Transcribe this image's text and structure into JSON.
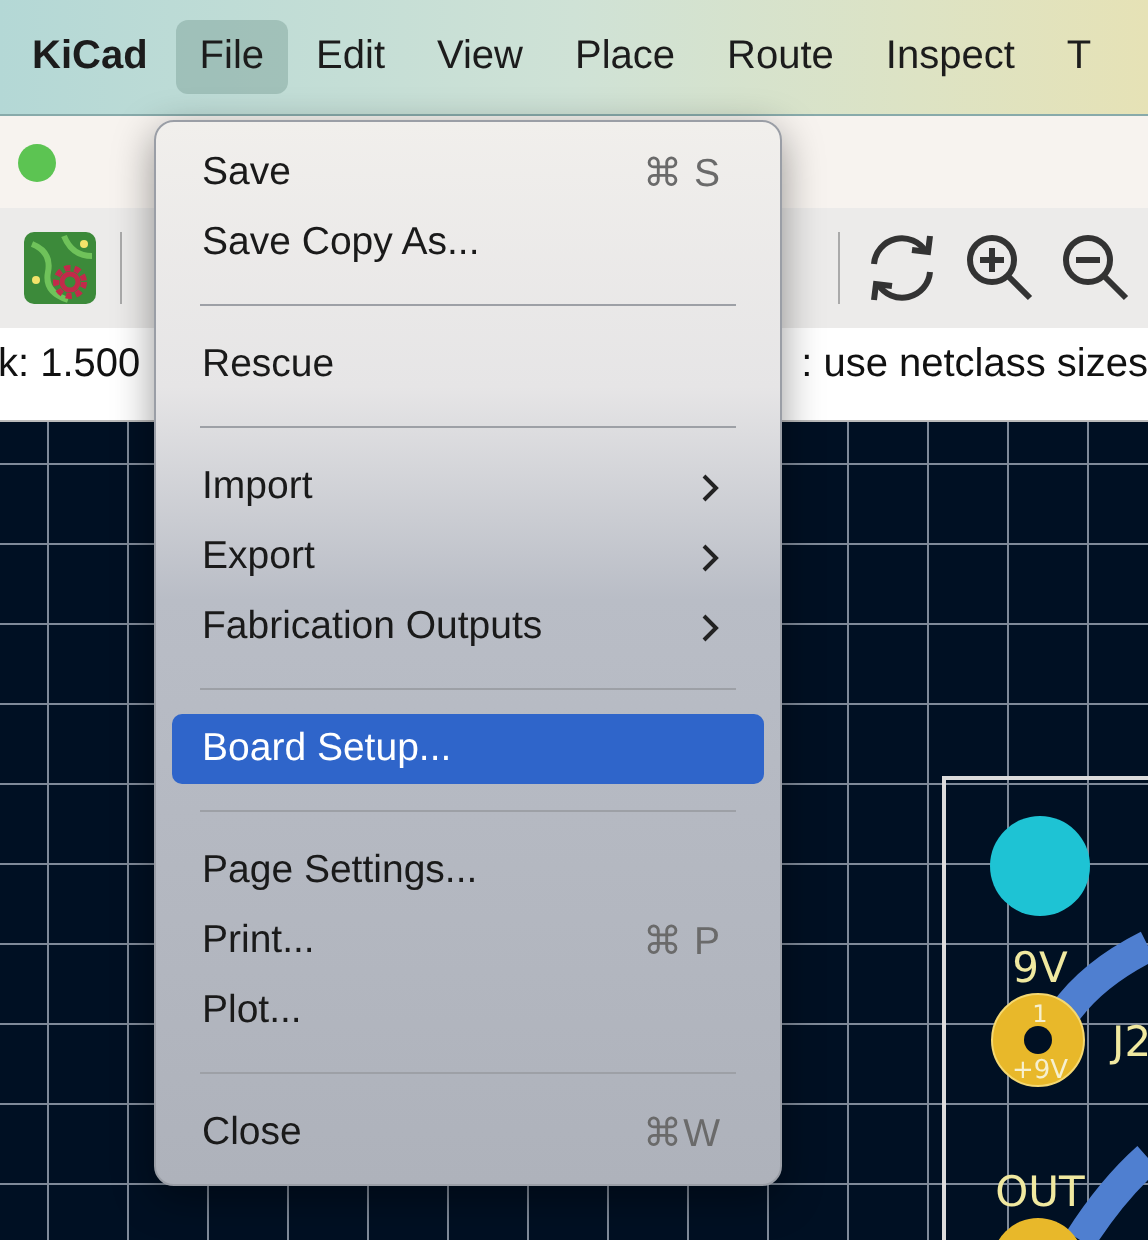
{
  "menu_bar": {
    "items": [
      {
        "label": "KiCad",
        "kind": "app",
        "selected": false
      },
      {
        "label": "File",
        "kind": "menu",
        "selected": true
      },
      {
        "label": "Edit",
        "kind": "menu",
        "selected": false
      },
      {
        "label": "View",
        "kind": "menu",
        "selected": false
      },
      {
        "label": "Place",
        "kind": "menu",
        "selected": false
      },
      {
        "label": "Route",
        "kind": "menu",
        "selected": false
      },
      {
        "label": "Inspect",
        "kind": "menu",
        "selected": false
      },
      {
        "label": "T",
        "kind": "menu",
        "selected": false
      }
    ]
  },
  "options_bar": {
    "texts": [
      "k: 1.500",
      ": use netclass sizes"
    ]
  },
  "file_menu": {
    "items": [
      {
        "kind": "item",
        "label": "Save",
        "shortcut": "⌘ S",
        "submenu": false,
        "selected": false
      },
      {
        "kind": "item",
        "label": "Save Copy As...",
        "submenu": false,
        "selected": false
      },
      {
        "kind": "separator"
      },
      {
        "kind": "item",
        "label": "Rescue",
        "submenu": false,
        "selected": false
      },
      {
        "kind": "separator"
      },
      {
        "kind": "item",
        "label": "Import",
        "submenu": true,
        "selected": false
      },
      {
        "kind": "item",
        "label": "Export",
        "submenu": true,
        "selected": false
      },
      {
        "kind": "item",
        "label": "Fabrication Outputs",
        "submenu": true,
        "selected": false
      },
      {
        "kind": "separator"
      },
      {
        "kind": "item",
        "label": "Board Setup...",
        "submenu": false,
        "selected": true
      },
      {
        "kind": "separator"
      },
      {
        "kind": "item",
        "label": "Page Settings...",
        "submenu": false,
        "selected": false
      },
      {
        "kind": "item",
        "label": "Print...",
        "shortcut": "⌘ P",
        "submenu": false,
        "selected": false
      },
      {
        "kind": "item",
        "label": "Plot...",
        "submenu": false,
        "selected": false
      },
      {
        "kind": "separator"
      },
      {
        "kind": "item",
        "label": "Close",
        "shortcut": "⌘W",
        "submenu": false,
        "selected": false
      }
    ]
  },
  "pcb": {
    "net_labels": [
      "9V",
      "OUT"
    ],
    "pad": {
      "number": "1",
      "net": "+9V"
    },
    "reference": "J2"
  }
}
